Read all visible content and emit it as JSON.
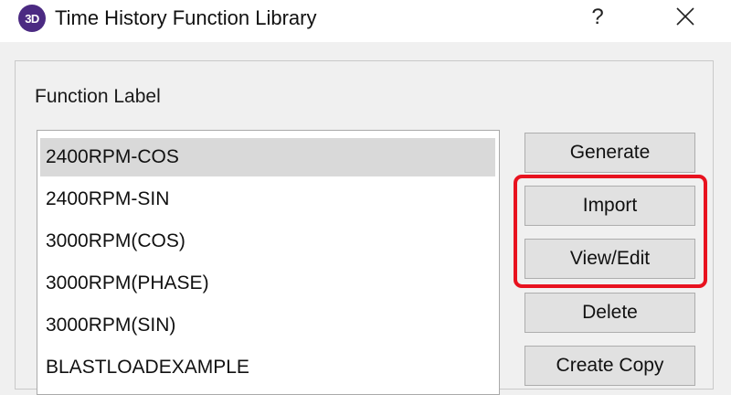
{
  "window": {
    "app_icon_text": "3D",
    "title": "Time History Function Library",
    "help_glyph": "?",
    "close_icon": "close-icon"
  },
  "group": {
    "label": "Function Label"
  },
  "functions": [
    {
      "label": "2400RPM-COS",
      "selected": true
    },
    {
      "label": "2400RPM-SIN",
      "selected": false
    },
    {
      "label": "3000RPM(COS)",
      "selected": false
    },
    {
      "label": "3000RPM(PHASE)",
      "selected": false
    },
    {
      "label": "3000RPM(SIN)",
      "selected": false
    },
    {
      "label": "BLASTLOADEXAMPLE",
      "selected": false
    }
  ],
  "buttons": {
    "generate": "Generate",
    "import": "Import",
    "view_edit": "View/Edit",
    "delete": "Delete",
    "create_copy": "Create Copy"
  },
  "colors": {
    "highlight": "#e8121f",
    "app_icon": "#4b2a82",
    "selection": "#d9d9d9"
  }
}
